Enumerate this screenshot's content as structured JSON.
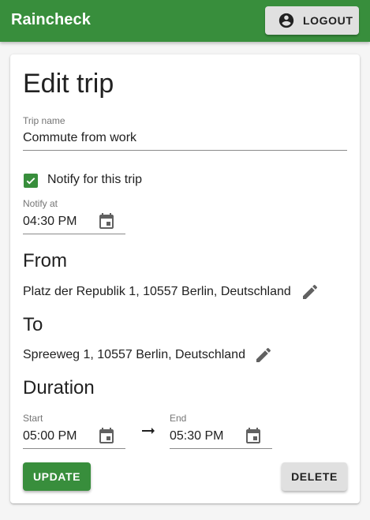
{
  "app": {
    "title": "Raincheck",
    "accent": "#388e3c"
  },
  "header": {
    "logout_label": "LOGOUT",
    "logout_icon": "account-circle-icon"
  },
  "form": {
    "title": "Edit trip",
    "trip_name": {
      "label": "Trip name",
      "value": "Commute from work"
    },
    "notify": {
      "label": "Notify for this trip",
      "checked": true
    },
    "notify_at": {
      "label": "Notify at",
      "value": "04:30 PM",
      "icon": "calendar-icon"
    },
    "from": {
      "heading": "From",
      "address": "Platz der Republik 1, 10557 Berlin, Deutschland",
      "icon": "pencil-icon"
    },
    "to": {
      "heading": "To",
      "address": "Spreeweg 1, 10557 Berlin, Deutschland",
      "icon": "pencil-icon"
    },
    "duration": {
      "heading": "Duration",
      "start": {
        "label": "Start",
        "value": "05:00 PM"
      },
      "end": {
        "label": "End",
        "value": "05:30 PM"
      },
      "separator_icon": "arrow-right-icon"
    },
    "update_label": "UPDATE",
    "delete_label": "DELETE"
  }
}
